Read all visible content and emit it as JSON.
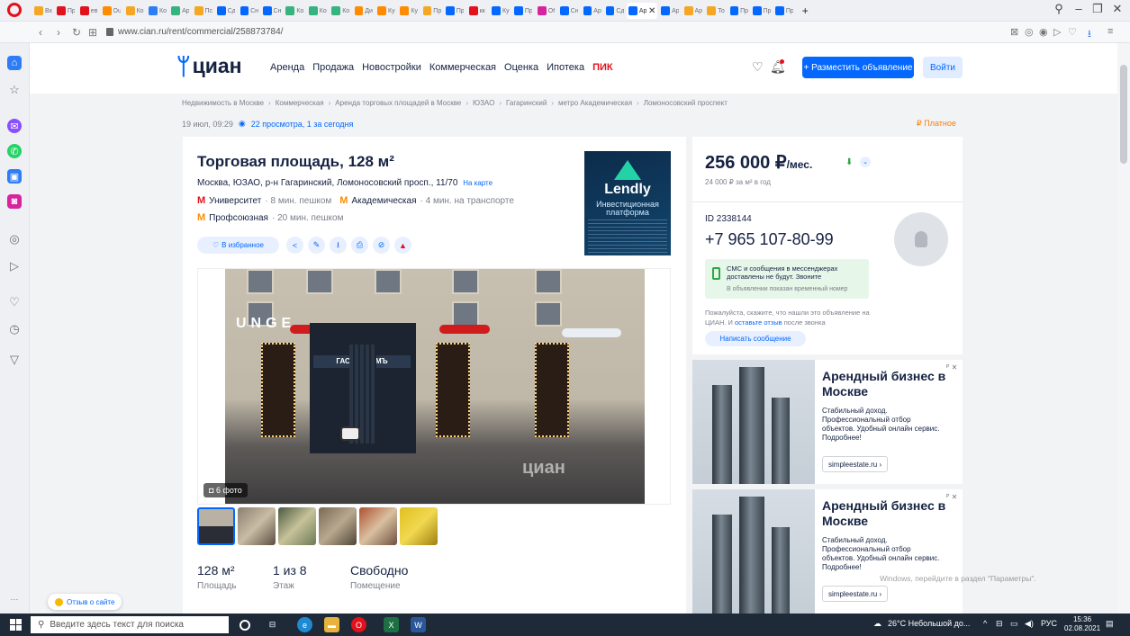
{
  "browser": {
    "tabs": [
      "Вх",
      "Пр",
      "ев",
      "Ou",
      "Ко",
      "Ко",
      "Ар",
      "Пс",
      "Сд",
      "Сн",
      "Сн",
      "Ко",
      "Ко",
      "Ко",
      "Ди",
      "Ку",
      "Ку",
      "Пр",
      "Пр",
      "кк",
      "Ку",
      "Пр",
      "Оf",
      "Сн",
      "Ар",
      "Сд",
      "Ар",
      "Ар",
      "Ар",
      "То",
      "Пр",
      "Пр",
      "Пр"
    ],
    "active_tab": "Ар",
    "new_tab": "+",
    "url": "www.cian.ru/rent/commercial/258873784/"
  },
  "header": {
    "logo_text": "циан",
    "nav": [
      "Аренда",
      "Продажа",
      "Новостройки",
      "Коммерческая",
      "Оценка",
      "Ипотека"
    ],
    "nav_pik": "ПИК",
    "post_button": "+ Разместить объявление",
    "login_button": "Войти"
  },
  "breadcrumbs": [
    "Недвижимость в Москве",
    "Коммерческая",
    "Аренда торговых площадей в Москве",
    "ЮЗАО",
    "Гагаринский",
    "метро Академическая",
    "Ломоносовский проспект"
  ],
  "meta": {
    "date": "19 июл, 09:29",
    "views": "22 просмотра, 1 за сегодня",
    "paid": "Платное"
  },
  "listing": {
    "title": "Торговая площадь, 128 м²",
    "address": "Москва, ЮЗАО, р-н Гагаринский, Ломоносовский просп., 11/70",
    "map_link": "На карте",
    "metro": [
      {
        "name": "Университет",
        "time": "· 8 мин. пешком"
      },
      {
        "name": "Академическая",
        "time": "· 4 мин. на транспорте"
      },
      {
        "name": "Профсоюзная",
        "time": "· 20 мин. пешком"
      }
    ],
    "favorite_button": "В избранное",
    "photo_count": "6 фото",
    "photo_sign": "ГАСТРОНОМЪ",
    "photo_letters": "UNGE",
    "photo_watermark": "циан",
    "stats": [
      {
        "value": "128 м²",
        "label": "Площадь"
      },
      {
        "value": "1 из 8",
        "label": "Этаж"
      },
      {
        "value": "Свободно",
        "label": "Помещение"
      }
    ]
  },
  "ad_banner": {
    "brand": "Lendly",
    "subtitle": "Инвестиционная платформа"
  },
  "price_card": {
    "price": "256 000 ₽",
    "price_unit": "/мес.",
    "price_per_m2": "24 000 ₽ за м² в год",
    "id": "ID 2338144",
    "phone": "+7 965 107-80-99",
    "sms_title": "СМС и сообщения в мессенджерах доставлены не будут. Звоните",
    "sms_sub": "В объявлении показан временный номер",
    "feedback_1": "Пожалуйста, скажите, что нашли это объявление на ЦИАН. И",
    "feedback_link": "оставьте отзыв",
    "feedback_2": "после звонка",
    "message_button": "Написать сообщение"
  },
  "promos": [
    {
      "title": "Арендный бизнес в Москве",
      "text": "Стабильный доход. Профессиональный отбор объектов. Удобный онлайн сервис. Подробнее!",
      "link": "simpleestate.ru ›"
    },
    {
      "title": "Арендный бизнес в Москве",
      "text": "Стабильный доход. Профессиональный отбор объектов. Удобный онлайн сервис. Подробнее!",
      "link": "simpleestate.ru ›"
    }
  ],
  "site_review": "Отзыв о сайте",
  "activation": "Windows, перейдите в раздел \"Параметры\".",
  "taskbar": {
    "search_placeholder": "Введите здесь текст для поиска",
    "weather": "26°C Небольшой до...",
    "lang": "РУС",
    "time": "15:36",
    "date": "02.08.2021"
  },
  "colors": {
    "brand_blue": "#0468ff",
    "brand_dark": "#152242",
    "accent_red": "#e3111c",
    "paid_orange": "#ff7d00",
    "sms_green_bg": "#e6f7e9"
  }
}
